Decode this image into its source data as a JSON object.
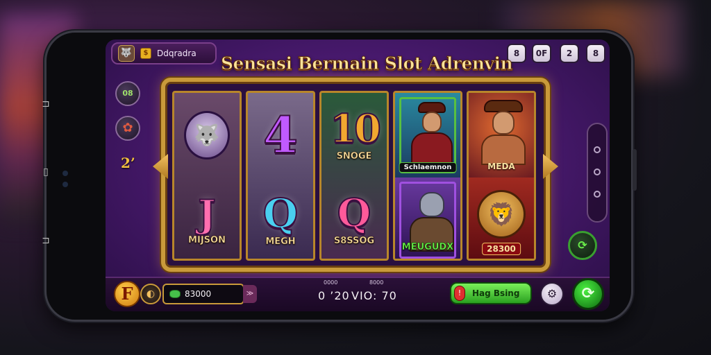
{
  "header": {
    "profile_name": "Ddqradra",
    "title": "Sensasi Bermain Slot Adrenvin",
    "buttons": [
      {
        "label": "8",
        "icon": "lock-icon"
      },
      {
        "label": "0F",
        "icon": "menu-icon"
      },
      {
        "label": "2",
        "icon": "badge-icon"
      },
      {
        "label": "8",
        "icon": "user-icon"
      }
    ]
  },
  "sidebar": {
    "icon1_label": "08",
    "number": "2’"
  },
  "reels": [
    {
      "top_symbol": "wolf",
      "bottom_symbol": "J",
      "bottom_label": "MIJSON"
    },
    {
      "top_symbol": "4",
      "bottom_symbol": "Q",
      "bottom_label": "MEGH"
    },
    {
      "top_symbol": "10",
      "top_label": "SNOGE",
      "bottom_symbol": "Q",
      "bottom_label": "S8SSOG"
    },
    {
      "top_label": "Schlaemnon",
      "bottom_label": "MEUGUDX"
    },
    {
      "top_label": "MEDA",
      "bottom_label": "28300"
    }
  ],
  "footer": {
    "coin_label": "F",
    "balance": "83000",
    "stat1_small": "0000",
    "stat1_value": "0 ’20",
    "stat2_small": "8000",
    "stat2_value": "VIO: 70",
    "play_label": "Hag Bsing",
    "play_icon_label": "!"
  },
  "colors": {
    "accent_gold": "#c99a3a",
    "bg_purple": "#4a1a70",
    "play_green": "#2aa020"
  }
}
